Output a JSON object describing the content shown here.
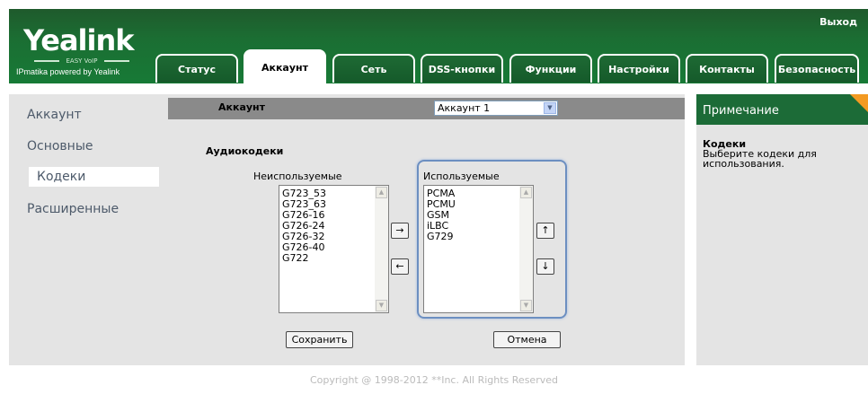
{
  "header": {
    "logo_word": "Yealink",
    "logo_tagline": "EASY VoIP",
    "logo_sub": "IPmatika powered by Yealink",
    "logout": "Выход",
    "tabs": [
      {
        "label": "Статус"
      },
      {
        "label": "Аккаунт"
      },
      {
        "label": "Сеть"
      },
      {
        "label": "DSS-кнопки"
      },
      {
        "label": "Функции"
      },
      {
        "label": "Настройки"
      },
      {
        "label": "Контакты"
      },
      {
        "label": "Безопасность"
      }
    ],
    "active_tab": "Аккаунт"
  },
  "sidebar": {
    "items": [
      {
        "label": "Аккаунт"
      },
      {
        "label": "Основные"
      },
      {
        "label": "Кодеки"
      },
      {
        "label": "Расширенные"
      }
    ],
    "active": "Кодеки"
  },
  "main": {
    "account_label": "Аккаунт",
    "account_select": "Аккаунт 1",
    "codecs_title": "Аудиокодеки",
    "unused_label": "Неиспользуемые",
    "used_label": "Используемые",
    "unused_codecs": [
      "G723_53",
      "G723_63",
      "G726-16",
      "G726-24",
      "G726-32",
      "G726-40",
      "G722"
    ],
    "used_codecs": [
      "PCMA",
      "PCMU",
      "GSM",
      "iLBC",
      "G729"
    ],
    "move_right": "→",
    "move_left": "←",
    "move_up": "↑",
    "move_down": "↓",
    "save": "Сохранить",
    "cancel": "Отмена"
  },
  "note": {
    "header": "Примечание",
    "title": "Кодеки",
    "text": "Выберите кодеки для использования."
  },
  "footer": {
    "copyright": "Copyright @ 1998-2012 **Inc. All Rights Reserved"
  },
  "colors": {
    "header_green": "#1b6e33",
    "note_accent": "#f39a22",
    "panel_gray": "#e4e4e4",
    "highlight_border": "#6c8fc1"
  }
}
